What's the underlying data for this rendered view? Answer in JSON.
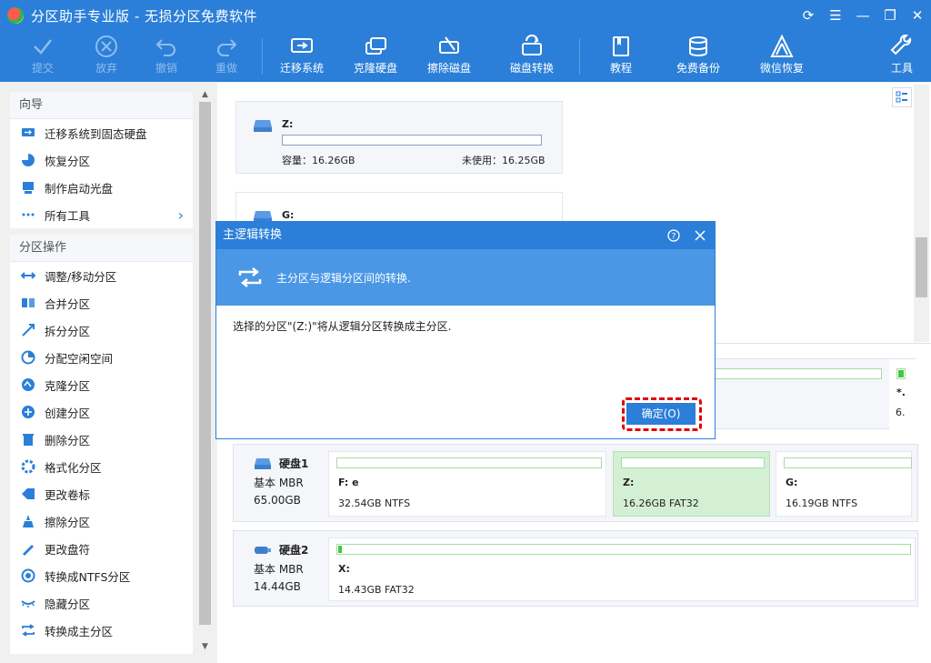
{
  "window": {
    "title": "分区助手专业版 - 无损分区免费软件"
  },
  "toolbar": {
    "commit": "提交",
    "discard": "放弃",
    "undo": "撤销",
    "redo": "重做",
    "migrate_os": "迁移系统",
    "clone_disk": "克隆硬盘",
    "wipe_disk": "擦除磁盘",
    "disk_convert": "磁盘转换",
    "tutorial": "教程",
    "free_backup": "免费备份",
    "wechat_restore": "微信恢复",
    "tools": "工具"
  },
  "sidebar": {
    "wizard_header": "向导",
    "wizard_items": [
      {
        "label": "迁移系统到固态硬盘",
        "icon": "migrate-icon"
      },
      {
        "label": "恢复分区",
        "icon": "recover-icon"
      },
      {
        "label": "制作启动光盘",
        "icon": "bootdisk-icon"
      },
      {
        "label": "所有工具",
        "icon": "dots-icon"
      }
    ],
    "ops_header": "分区操作",
    "ops_items": [
      {
        "label": "调整/移动分区",
        "icon": "resize-icon"
      },
      {
        "label": "合并分区",
        "icon": "merge-icon"
      },
      {
        "label": "拆分分区",
        "icon": "split-icon"
      },
      {
        "label": "分配空闲空间",
        "icon": "allocate-icon"
      },
      {
        "label": "克隆分区",
        "icon": "clone-icon"
      },
      {
        "label": "创建分区",
        "icon": "create-icon"
      },
      {
        "label": "删除分区",
        "icon": "delete-icon"
      },
      {
        "label": "格式化分区",
        "icon": "format-icon"
      },
      {
        "label": "更改卷标",
        "icon": "label-icon"
      },
      {
        "label": "擦除分区",
        "icon": "wipe-icon"
      },
      {
        "label": "更改盘符",
        "icon": "letter-icon"
      },
      {
        "label": "转换成NTFS分区",
        "icon": "ntfs-icon"
      },
      {
        "label": "隐藏分区",
        "icon": "hide-icon"
      },
      {
        "label": "转换成主分区",
        "icon": "convert-icon"
      }
    ]
  },
  "partition_cards": [
    {
      "name": "Z:",
      "capacity": "容量：16.26GB",
      "unused": "未使用：16.25GB"
    },
    {
      "name": "G:"
    }
  ],
  "dialog": {
    "title": "主逻辑转换",
    "header_text": "主分区与逻辑分区间的转换.",
    "message": "选择的分区\"(Z:)\"将从逻辑分区转换成主分区.",
    "ok_label": "确定(O)"
  },
  "disk_map_partial": {
    "label1": "*.",
    "label2": "6."
  },
  "disks": [
    {
      "name": "硬盘1",
      "type": "基本 MBR",
      "size": "65.00GB",
      "partitions": [
        {
          "label": "F: e",
          "info": "32.54GB NTFS"
        },
        {
          "label": "Z:",
          "info": "16.26GB FAT32"
        },
        {
          "label": "G:",
          "info": "16.19GB NTFS"
        }
      ]
    },
    {
      "name": "硬盘2",
      "type": "基本 MBR",
      "size": "14.44GB",
      "partitions": [
        {
          "label": "X:",
          "info": "14.43GB FAT32"
        }
      ]
    }
  ],
  "colors": {
    "accent": "#2b7fd8",
    "selected_partition": "#d4f0d4",
    "highlight": "#e00000"
  }
}
